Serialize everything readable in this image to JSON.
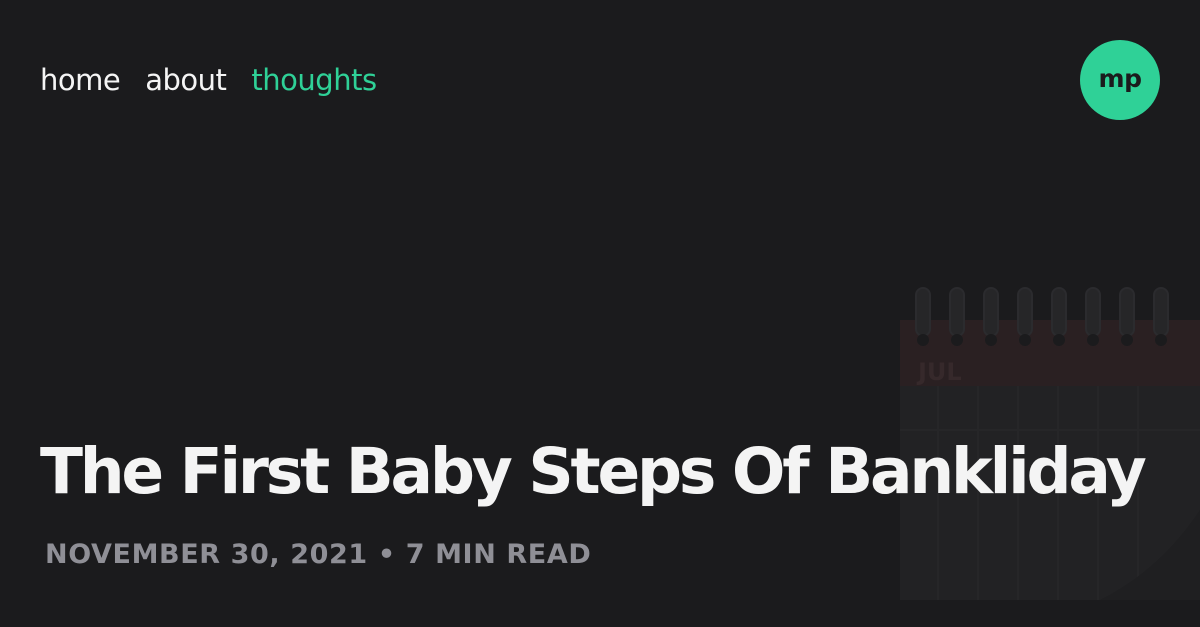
{
  "nav": {
    "items": [
      {
        "label": "home",
        "active": false
      },
      {
        "label": "about",
        "active": false
      },
      {
        "label": "thoughts",
        "active": true
      }
    ]
  },
  "logo": {
    "text": "mp"
  },
  "post": {
    "title": "The First Baby Steps Of Bankliday",
    "date": "NOVEMBER 30, 2021",
    "separator": "•",
    "read_time": "7 MIN READ"
  },
  "illustration": {
    "icon": "calendar-icon",
    "month": "JUL"
  },
  "colors": {
    "background": "#1b1b1d",
    "accent": "#2fd197",
    "text": "#f4f4f4",
    "muted": "#8f8f96"
  }
}
